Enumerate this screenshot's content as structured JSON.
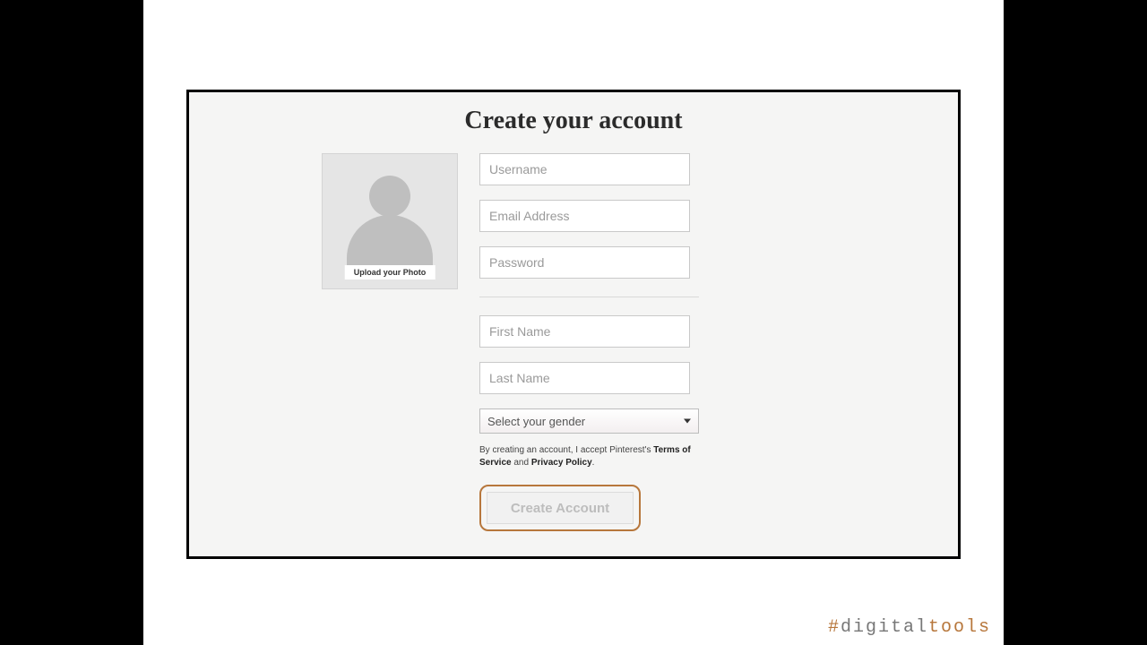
{
  "title": "Create your account",
  "photo": {
    "upload_label": "Upload your Photo"
  },
  "fields": {
    "username": "Username",
    "email": "Email Address",
    "password": "Password",
    "first_name": "First Name",
    "last_name": "Last Name",
    "gender": "Select your gender"
  },
  "legal": {
    "prefix": "By creating an account, I accept Pinterest's ",
    "tos": "Terms of Service",
    "and": " and ",
    "privacy": "Privacy Policy",
    "suffix": "."
  },
  "button": {
    "create": "Create Account"
  },
  "watermark": {
    "hash": "#",
    "digital": "digital",
    "tools": "tools"
  }
}
